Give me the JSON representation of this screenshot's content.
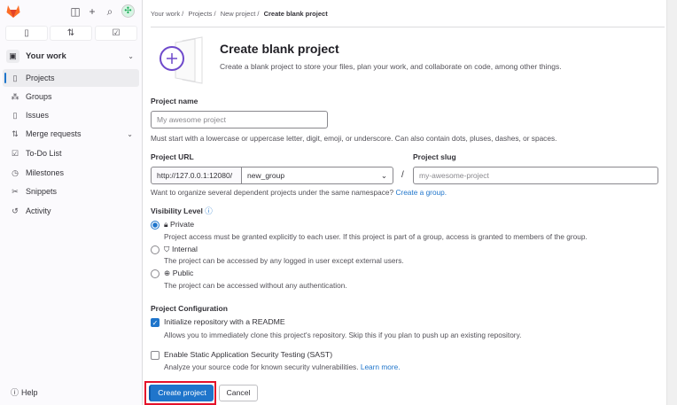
{
  "sidebar": {
    "section": "Your work",
    "items": [
      {
        "label": "Projects",
        "icon": "project-icon"
      },
      {
        "label": "Groups",
        "icon": "group-icon"
      },
      {
        "label": "Issues",
        "icon": "issues-icon"
      },
      {
        "label": "Merge requests",
        "icon": "merge-request-icon"
      },
      {
        "label": "To-Do List",
        "icon": "todo-icon"
      },
      {
        "label": "Milestones",
        "icon": "milestone-icon"
      },
      {
        "label": "Snippets",
        "icon": "snippet-icon"
      },
      {
        "label": "Activity",
        "icon": "history-icon"
      }
    ],
    "help": "Help"
  },
  "breadcrumb": [
    "Your work",
    "Projects",
    "New project",
    "Create blank project"
  ],
  "header": {
    "title": "Create blank project",
    "description": "Create a blank project to store your files, plan your work, and collaborate on code, among other things."
  },
  "form": {
    "name_label": "Project name",
    "name_placeholder": "My awesome project",
    "name_help": "Must start with a lowercase or uppercase letter, digit, emoji, or underscore. Can also contain dots, pluses, dashes, or spaces.",
    "url_label": "Project URL",
    "url_prefix": "http://127.0.0.1:12080/",
    "namespace": "new_group",
    "slash": "/",
    "slug_label": "Project slug",
    "slug_placeholder": "my-awesome-project",
    "group_help": "Want to organize several dependent projects under the same namespace?",
    "group_link": "Create a group.",
    "visibility_label": "Visibility Level",
    "visibility": [
      {
        "label": "Private",
        "desc": "Project access must be granted explicitly to each user. If this project is part of a group, access is granted to members of the group.",
        "checked": true
      },
      {
        "label": "Internal",
        "desc": "The project can be accessed by any logged in user except external users.",
        "checked": false
      },
      {
        "label": "Public",
        "desc": "The project can be accessed without any authentication.",
        "checked": false
      }
    ],
    "config_label": "Project Configuration",
    "readme_label": "Initialize repository with a README",
    "readme_desc": "Allows you to immediately clone this project's repository. Skip this if you plan to push up an existing repository.",
    "readme_checked": true,
    "sast_label": "Enable Static Application Security Testing (SAST)",
    "sast_desc": "Analyze your source code for known security vulnerabilities.",
    "sast_link": "Learn more.",
    "sast_checked": false,
    "create": "Create project",
    "cancel": "Cancel"
  },
  "colors": {
    "accent": "#1f75cb",
    "highlight": "#e5112a",
    "icon_purple": "#6e49cb"
  }
}
